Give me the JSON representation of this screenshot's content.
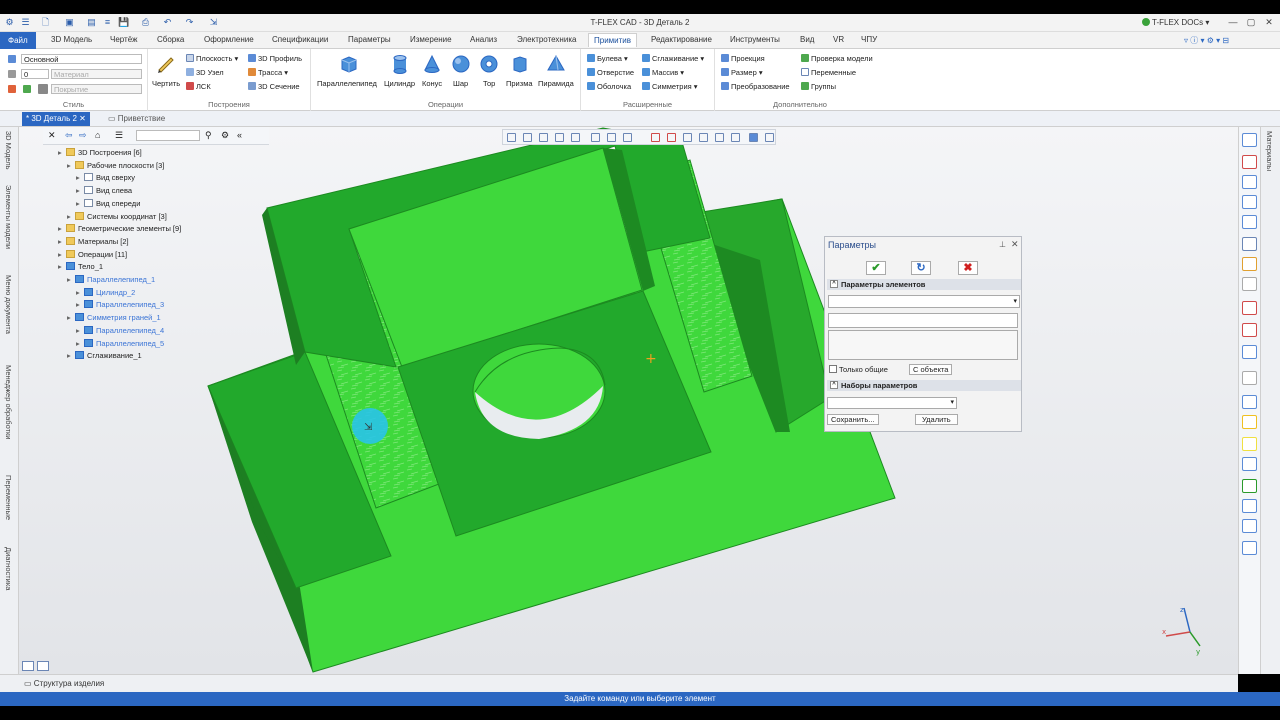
{
  "app": {
    "title": "T-FLEX CAD - 3D Деталь 2",
    "docs_label": "T-FLEX DOCs",
    "window_controls": [
      "—",
      "▢",
      "✕"
    ]
  },
  "menu": {
    "file": "Файл",
    "tabs": [
      "3D Модель",
      "Чертёж",
      "Сборка",
      "Оформление",
      "Спецификации",
      "Параметры",
      "Измерение",
      "Анализ",
      "Электротехника",
      "Примитив",
      "Редактирование",
      "Инструменты",
      "Вид",
      "VR",
      "ЧПУ"
    ],
    "active": "Примитив"
  },
  "ribbon": {
    "style": {
      "label": "Стиль",
      "layer": "Основной",
      "level": "0",
      "material": "Материал",
      "coating": "Покрытие"
    },
    "constructions": {
      "label": "Построения",
      "draw": "Чертить",
      "items": [
        "Плоскость",
        "3D Узел",
        "ЛСК",
        "3D Профиль",
        "Трасса",
        "3D Сечение"
      ]
    },
    "operations": {
      "label": "Операции",
      "items": [
        "Параллелепипед",
        "Цилиндр",
        "Конус",
        "Шар",
        "Тор",
        "Призма",
        "Пирамида"
      ]
    },
    "extended": {
      "label": "Расширенные",
      "items": [
        "Булева",
        "Отверстие",
        "Оболочка",
        "Сглаживание",
        "Массив",
        "Симметрия"
      ]
    },
    "extra": {
      "label": "Дополнительно",
      "items": [
        "Проекция",
        "Размер",
        "Преобразование",
        "Проверка модели",
        "Переменные",
        "Группы"
      ]
    }
  },
  "doc_tabs": {
    "active": "* 3D Деталь 2",
    "inactive": "Приветствие"
  },
  "left_strip": [
    "3D Модель",
    "Элементы модели",
    "Меню документа",
    "Менеджер обработки",
    "Переменные",
    "Диагностика"
  ],
  "right_strip": [
    "Материалы"
  ],
  "tree": [
    {
      "label": "3D Построения [6]",
      "indent": 1,
      "icon": "fold"
    },
    {
      "label": "Рабочие плоскости [3]",
      "indent": 2,
      "icon": "fold"
    },
    {
      "label": "Вид сверху",
      "indent": 3,
      "icon": "view"
    },
    {
      "label": "Вид слева",
      "indent": 3,
      "icon": "view"
    },
    {
      "label": "Вид спереди",
      "indent": 3,
      "icon": "view"
    },
    {
      "label": "Системы координат [3]",
      "indent": 2,
      "icon": "fold"
    },
    {
      "label": "Геометрические элементы [9]",
      "indent": 1,
      "icon": "fold"
    },
    {
      "label": "Материалы [2]",
      "indent": 1,
      "icon": "fold"
    },
    {
      "label": "Операции [11]",
      "indent": 1,
      "icon": "fold"
    },
    {
      "label": "Тело_1",
      "indent": 1,
      "icon": "blue3d"
    },
    {
      "label": "Параллелепипед_1",
      "indent": 2,
      "icon": "blue3d",
      "link": true
    },
    {
      "label": "Цилиндр_2",
      "indent": 3,
      "icon": "blue3d",
      "link": true
    },
    {
      "label": "Параллелепипед_3",
      "indent": 3,
      "icon": "blue3d",
      "link": true
    },
    {
      "label": "Симметрия граней_1",
      "indent": 2,
      "icon": "blue3d",
      "link": true
    },
    {
      "label": "Параллелепипед_4",
      "indent": 3,
      "icon": "blue3d",
      "link": true
    },
    {
      "label": "Параллелепипед_5",
      "indent": 3,
      "icon": "blue3d",
      "link": true
    },
    {
      "label": "Сглаживание_1",
      "indent": 2,
      "icon": "blue3d"
    }
  ],
  "params_panel": {
    "title": "Параметры",
    "section_elements": "Параметры элементов",
    "only_common": "Только общие",
    "from_object": "С объекта",
    "section_sets": "Наборы параметров",
    "save": "Сохранить...",
    "delete": "Удалить",
    "ok": "✔",
    "refresh": "↻",
    "cancel": "✖"
  },
  "bottom_tab": "Структура изделия",
  "status": "Задайте команду или выберите элемент",
  "colors": {
    "accent": "#2b67c2",
    "model_green": "#22a92c",
    "model_light": "#3fd83c"
  },
  "axes": [
    "x",
    "y",
    "z"
  ]
}
